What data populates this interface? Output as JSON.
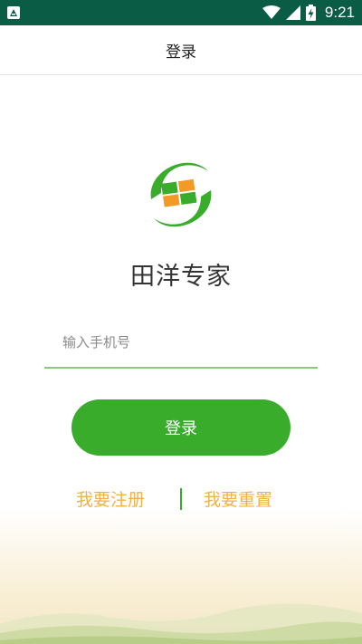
{
  "status_bar": {
    "time": "9:21",
    "icons": [
      "app-notification-icon",
      "wifi-icon",
      "signal-icon",
      "battery-charging-icon"
    ]
  },
  "nav": {
    "title": "登录"
  },
  "brand": {
    "logo_icon": "tianyang-logo-icon",
    "name": "田洋专家"
  },
  "form": {
    "phone_placeholder": "输入手机号",
    "phone_value": "",
    "login_label": "登录"
  },
  "links": {
    "register": "我要注册",
    "reset": "我要重置"
  },
  "colors": {
    "status_bar": "#0b5c45",
    "primary_green": "#3aac2c",
    "input_underline": "#8cc97c",
    "link_orange": "#eeb24a",
    "logo_orange": "#f29a25"
  }
}
